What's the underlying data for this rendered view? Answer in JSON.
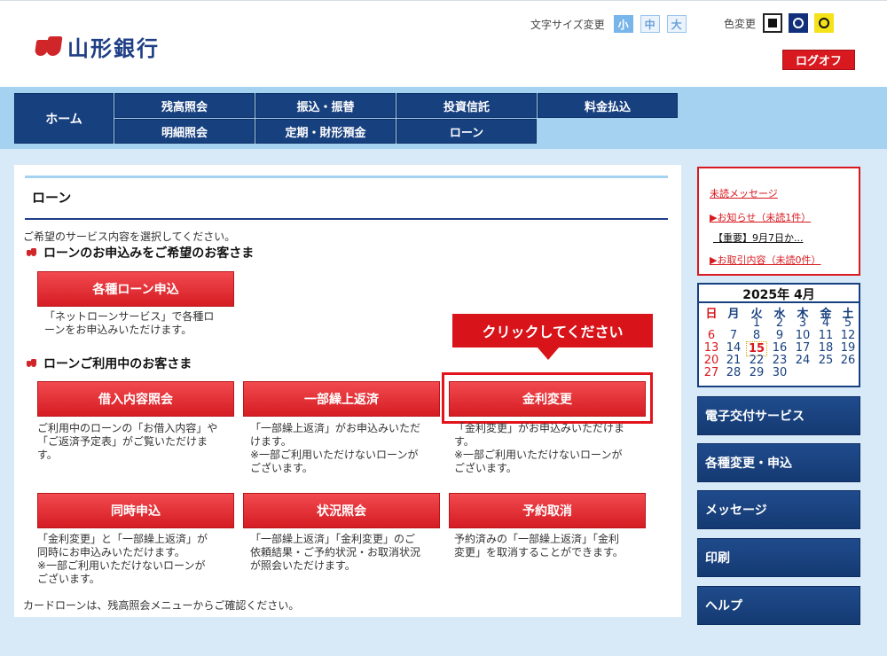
{
  "header": {
    "logo_text": "山形銀行",
    "font_size_label": "文字サイズ変更",
    "font_sizes": [
      "小",
      "中",
      "大"
    ],
    "color_label": "色変更",
    "logout": "ログオフ"
  },
  "nav": {
    "home": "ホーム",
    "row1": [
      "残高照会",
      "振込・振替",
      "投資信託",
      "料金払込"
    ],
    "row2": [
      "明細照会",
      "定期・財形預金",
      "ローン"
    ]
  },
  "main": {
    "title": "ローン",
    "intro": "ご希望のサービス内容を選択してください。",
    "section1": "ローンのお申込みをご希望のお客さま",
    "section2": "ローンご利用中のお客さま",
    "buttons": {
      "apply": "各種ローン申込",
      "borrow_inquiry": "借入内容照会",
      "partial_repay": "一部繰上返済",
      "rate_change": "金利変更",
      "simultaneous": "同時申込",
      "status": "状況照会",
      "cancel": "予約取消"
    },
    "desc": {
      "apply": [
        "「ネットローンサービス」で各種ロ",
        "ーンをお申込みいただけます。"
      ],
      "borrow_inquiry": [
        "ご利用中のローンの「お借入内容」や",
        "「ご返済予定表」がご覧いただけま",
        "す。"
      ],
      "partial_repay": [
        "「一部繰上返済」がお申込みいただ",
        "けます。",
        "※一部ご利用いただけないローンが",
        "ございます。"
      ],
      "rate_change": [
        "「金利変更」がお申込みいただけま",
        "す。",
        "※一部ご利用いただけないローンが",
        "ございます。"
      ],
      "simultaneous": [
        "「金利変更」と「一部繰上返済」が",
        "同時にお申込みいただけます。",
        "※一部ご利用いただけないローンが",
        "ございます。"
      ],
      "status": [
        "「一部繰上返済」「金利変更」のご",
        "依頼結果・ご予約状況・お取消状況",
        "が照会いただけます。"
      ],
      "cancel": [
        "予約済みの「一部繰上返済」「金利",
        "変更」を取消することができます。"
      ]
    },
    "tooltip": "クリックしてください",
    "footer_note": "カードローンは、残高照会メニューからご確認ください。"
  },
  "sidebar": {
    "messages": {
      "unread": "未読メッセージ",
      "notice": "▶お知らせ（未読1件）",
      "important": "【重要】9月7日か...",
      "transactions": "▶お取引内容（未読0件）"
    },
    "calendar": {
      "title": "2025年 4月",
      "weekdays": [
        "日",
        "月",
        "火",
        "水",
        "木",
        "金",
        "土"
      ],
      "today": "15",
      "weeks": [
        [
          "",
          "",
          "1",
          "2",
          "3",
          "4",
          "5"
        ],
        [
          "6",
          "7",
          "8",
          "9",
          "10",
          "11",
          "12"
        ],
        [
          "13",
          "14",
          "15",
          "16",
          "17",
          "18",
          "19"
        ],
        [
          "20",
          "21",
          "22",
          "23",
          "24",
          "25",
          "26"
        ],
        [
          "27",
          "28",
          "29",
          "30",
          "",
          "",
          ""
        ]
      ]
    },
    "buttons": [
      "電子交付サービス",
      "各種変更・申込",
      "メッセージ",
      "印刷",
      "ヘルプ"
    ]
  },
  "colors": {
    "navy": "#17407f",
    "light_blue": "#a6d2f2",
    "red": "#d8191f",
    "page_bg": "#d8e9f8"
  }
}
